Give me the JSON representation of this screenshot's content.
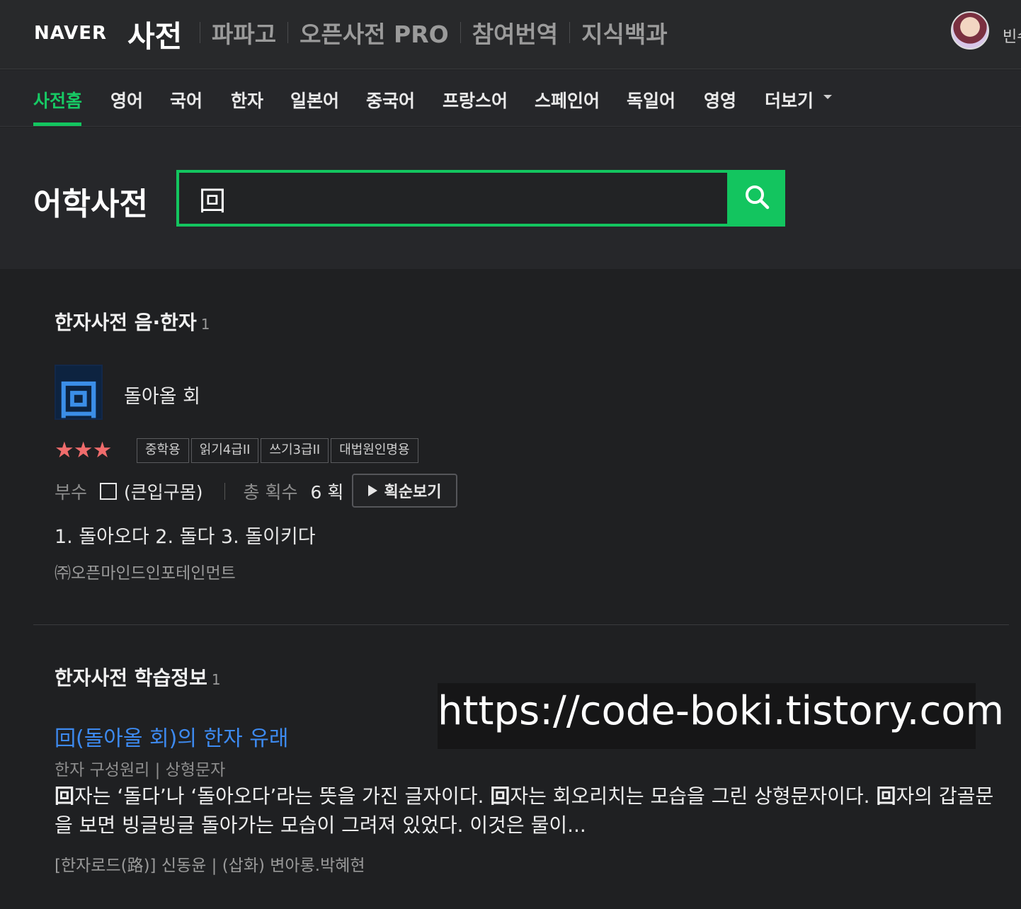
{
  "header": {
    "logo_naver": "NAVER",
    "logo_dict": "사전",
    "services": [
      "파파고",
      "오픈사전 PRO",
      "참여번역",
      "지식백과"
    ],
    "user_name": "빈수"
  },
  "nav": {
    "tabs": [
      "사전홈",
      "영어",
      "국어",
      "한자",
      "일본어",
      "중국어",
      "프랑스어",
      "스페인어",
      "독일어",
      "영영",
      "더보기"
    ],
    "active": "사전홈"
  },
  "search": {
    "title": "어학사전",
    "query": "回",
    "button_icon": "search-icon"
  },
  "hanja_section": {
    "title": "한자사전 음·한자",
    "count": "1",
    "char": "回",
    "meaning": "돌아올 회",
    "stars": "★★★",
    "badges": [
      "중학용",
      "읽기4급II",
      "쓰기3급II",
      "대법원인명용"
    ],
    "radical_label": "부수",
    "radical_name": "(큰입구몸)",
    "stroke_label": "총 획수",
    "stroke_value": "6 획",
    "stroke_button": "획순보기",
    "meanings": "1.  돌아오다   2.  돌다   3.  돌이키다",
    "source": "㈜오픈마인드인포테인먼트"
  },
  "learn_section": {
    "title": "한자사전 학습정보",
    "count": "1",
    "link": "回(돌아올 회)의 한자 유래",
    "meta": "한자 구성원리 | 상형문자",
    "body_parts": [
      {
        "b": "回",
        "t": "자는 ‘돌다’나 ‘돌아오다’라는 뜻을 가진 글자이다. "
      },
      {
        "b": "回",
        "t": "자는 회오리치는 모습을 그린 상형문자이다. "
      },
      {
        "b": "回",
        "t": "자의 갑골문을 보면 빙글빙글 돌아가는 모습이 그려져 있었다. 이것은 물이..."
      }
    ],
    "source": "[한자로드(路)]  신동윤  |  (삽화)  변아롱.박혜현"
  },
  "watermark": "https://code-boki.tistory.com",
  "colors": {
    "accent_green": "#13c55f",
    "link_blue": "#3d8af0",
    "star_red": "#f06c6c",
    "background": "#1f2022"
  }
}
